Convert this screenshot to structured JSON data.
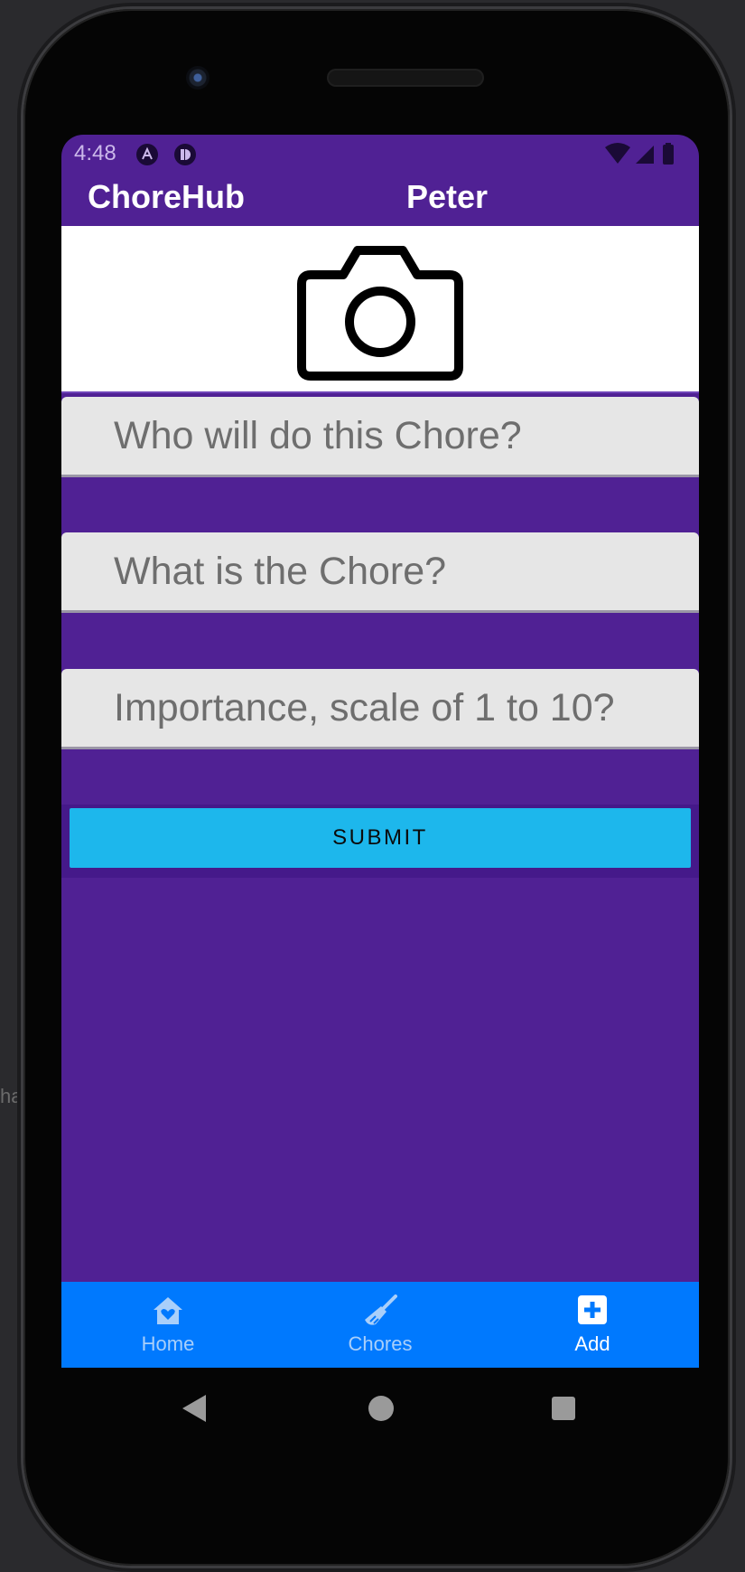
{
  "background_label": "ha",
  "status_bar": {
    "time": "4:48",
    "icons": [
      "app-notification-icon",
      "app-notification-icon-2",
      "wifi-icon",
      "signal-icon",
      "battery-icon"
    ]
  },
  "app_bar": {
    "title": "ChoreHub",
    "user": "Peter"
  },
  "photo": {
    "icon": "camera-icon"
  },
  "form": {
    "assignee_placeholder": "Who will do this Chore?",
    "chore_placeholder": "What is the Chore?",
    "importance_placeholder": "Importance, scale of 1 to 10?",
    "submit_label": "SUBMIT"
  },
  "bottom_nav": {
    "items": [
      {
        "label": "Home",
        "icon": "home-heart-icon",
        "active": false
      },
      {
        "label": "Chores",
        "icon": "broom-icon",
        "active": false
      },
      {
        "label": "Add",
        "icon": "plus-square-icon",
        "active": true
      }
    ]
  },
  "system_nav": [
    "back-icon",
    "home-circle-icon",
    "recents-square-icon"
  ],
  "colors": {
    "primary": "#502194",
    "accent_button": "#1db7ec",
    "bottom_nav": "#0079fe"
  }
}
